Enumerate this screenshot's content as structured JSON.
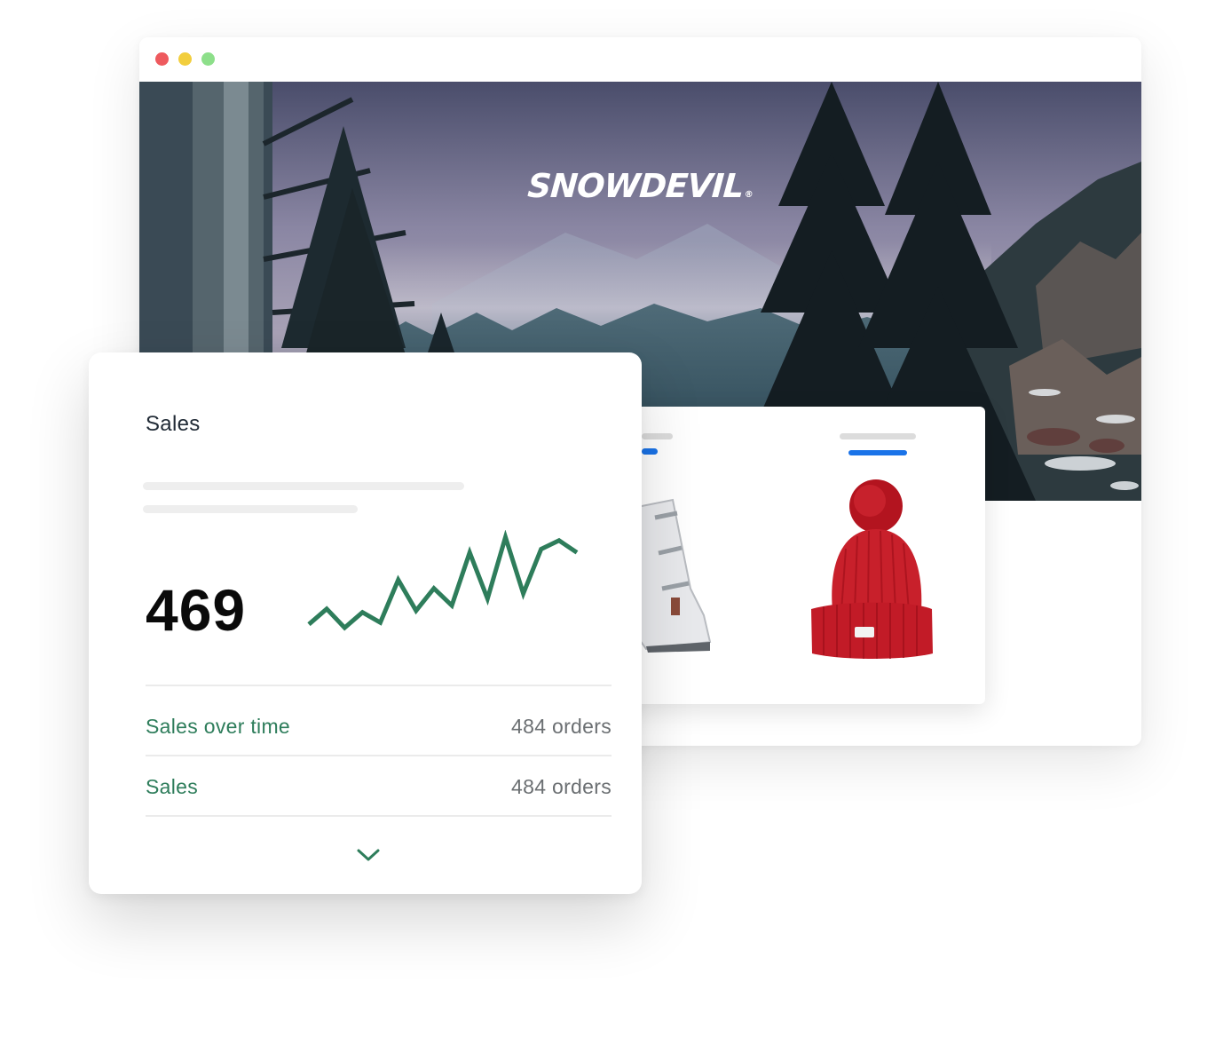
{
  "store": {
    "brand_name": "SNOWDEVIL",
    "brand_mark": "®"
  },
  "window_controls": [
    "close",
    "minimize",
    "maximize"
  ],
  "colors": {
    "close": "#ee5a5e",
    "minimize": "#f2ce3d",
    "maximize": "#8ddf8a",
    "accent_green": "#2e7d5b",
    "accent_blue": "#1a73e8",
    "product_hat": "#c8202b"
  },
  "products": [
    {
      "icon": "ski-boot-icon"
    },
    {
      "icon": "beanie-hat-icon"
    }
  ],
  "sales_card": {
    "title": "Sales",
    "total": "469",
    "rows": [
      {
        "label": "Sales over time",
        "value": "484 orders"
      },
      {
        "label": "Sales",
        "value": "484 orders"
      }
    ],
    "expand_icon": "chevron-down-icon"
  },
  "chart_data": {
    "type": "line",
    "title": "",
    "xlabel": "",
    "ylabel": "",
    "grid": false,
    "legend": "none",
    "series": [
      {
        "values": [
          5,
          14,
          3,
          12,
          6,
          31,
          13,
          26,
          16,
          47,
          20,
          56,
          23,
          49,
          54,
          47
        ]
      }
    ]
  }
}
